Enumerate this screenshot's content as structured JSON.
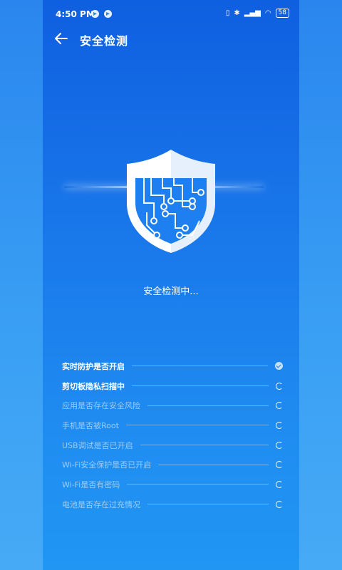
{
  "status_bar": {
    "time": "4:50 PM",
    "battery": "58",
    "icons": [
      "telegram-icon",
      "telegram-icon",
      "vibrate-icon",
      "bluetooth-icon",
      "signal-icon",
      "wifi-icon",
      "battery-icon"
    ]
  },
  "header": {
    "title": "安全检测",
    "back_icon": "arrow-left-icon"
  },
  "scan": {
    "status": "安全检测中..."
  },
  "checks": [
    {
      "label": "实时防护是否开启",
      "state": "done"
    },
    {
      "label": "剪切板隐私扫描中",
      "state": "loading"
    },
    {
      "label": "应用是否存在安全风险",
      "state": "pending"
    },
    {
      "label": "手机是否被Root",
      "state": "pending"
    },
    {
      "label": "USB调试是否已开启",
      "state": "pending"
    },
    {
      "label": "Wi-Fi安全保护是否已开启",
      "state": "pending"
    },
    {
      "label": "Wi-Fi是否有密码",
      "state": "pending"
    },
    {
      "label": "电池是否存在过充情况",
      "state": "pending"
    }
  ],
  "colors": {
    "bg_top": "#0f5fe0",
    "bg_bottom": "#2196f3",
    "text": "#ffffff"
  }
}
